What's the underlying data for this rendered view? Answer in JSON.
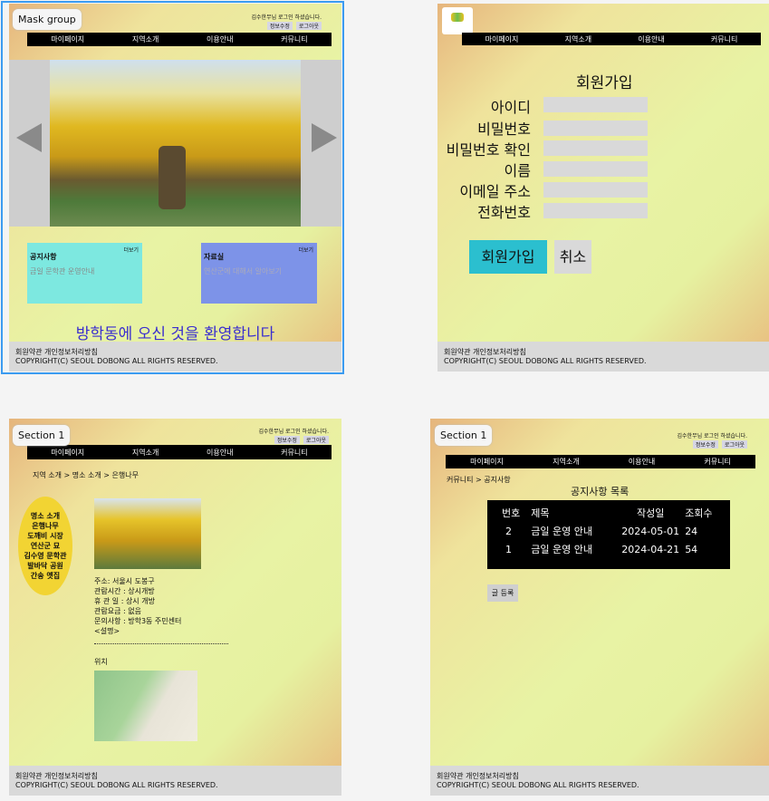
{
  "common": {
    "login_msg": "김수한무님 로그인 하셨습니다.",
    "edit_info": "정보수정",
    "logout": "로그아웃",
    "nav": [
      "마이페이지",
      "지역소개",
      "이용안내",
      "커뮤니티"
    ],
    "footer_line1": "회원약관 개인정보처리방침",
    "footer_line2": "COPYRIGHT(C) SEOUL DOBONG  ALL RIGHTS RESERVED."
  },
  "home": {
    "frame_label": "Mask group",
    "notice": {
      "title": "공지사항",
      "more": "더보기",
      "item": "금일 문학관 운영안내",
      "color": "#7de8e0"
    },
    "archive": {
      "title": "자료실",
      "more": "더보기",
      "item": "연산군에 대해서 알아보기",
      "color": "#7d93e8"
    },
    "welcome": "방학동에 오신 것을 환영합니다",
    "welcome_color": "#3a2ecf"
  },
  "signup": {
    "title": "회원가입",
    "fields": [
      "아이디",
      "비밀번호",
      "비밀번호 확인",
      "이름",
      "이메일 주소",
      "전화번호"
    ],
    "submit": "회원가입",
    "cancel": "취소",
    "submit_color": "#2bbfcf"
  },
  "detail": {
    "frame_label": "Section 1",
    "breadcrumb": "지역 소개 > 명소 소개 > 은행나무",
    "menu": [
      "명소 소개",
      "은행나무",
      "도깨비 시장",
      "연산군 묘",
      "김수영 문학관",
      "발바닥 공원",
      "간송 옛집"
    ],
    "info": [
      "주소: 서울시 도봉구",
      "관람시간 : 상시개방",
      "휴 관 일 : 상시 개방",
      "관람요금 : 없음",
      "문의사항 : 방학3동 주민센터",
      "<설명>"
    ],
    "location": "위치"
  },
  "board": {
    "frame_label": "Section 1",
    "breadcrumb": "커뮤니티 > 공지사항",
    "title": "공지사항 목록",
    "headers": [
      "번호",
      "제목",
      "작성일",
      "조회수"
    ],
    "rows": [
      [
        "2",
        "금일 운영 안내",
        "2024-05-01",
        "24"
      ],
      [
        "1",
        "금일 운영 안내",
        "2024-04-21",
        "54"
      ]
    ],
    "write": "글 등록"
  }
}
